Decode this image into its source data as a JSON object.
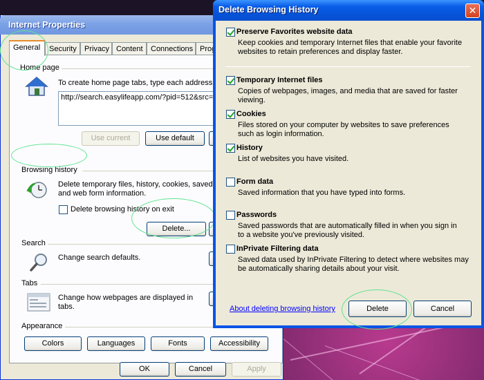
{
  "ie_window": {
    "title": "Internet Properties",
    "tabs": [
      "General",
      "Security",
      "Privacy",
      "Content",
      "Connections",
      "Prog"
    ],
    "home_page": {
      "label": "Home page",
      "description": "To create home page tabs, type each address on",
      "url": "http://search.easylifeapp.com/?pid=512&src=",
      "use_current": "Use current",
      "use_default": "Use default"
    },
    "browsing_history": {
      "label": "Browsing history",
      "description_line1": "Delete temporary files, history, cookies, saved",
      "description_line2": "and web form information.",
      "delete_on_exit": "Delete browsing history on exit",
      "delete_button": "Delete..."
    },
    "search": {
      "label": "Search",
      "description": "Change search defaults."
    },
    "tabs_section": {
      "label": "Tabs",
      "description_line1": "Change how webpages are displayed in",
      "description_line2": "tabs."
    },
    "appearance": {
      "label": "Appearance",
      "colors": "Colors",
      "languages": "Languages",
      "fonts": "Fonts",
      "accessibility": "Accessibility"
    },
    "footer": {
      "ok": "OK",
      "cancel": "Cancel",
      "apply": "Apply"
    }
  },
  "dialog": {
    "title": "Delete Browsing History",
    "options": [
      {
        "title": "Preserve Favorites website data",
        "checked": true,
        "desc1": "Keep cookies and temporary Internet files that enable your favorite",
        "desc2": "websites to retain preferences and display faster."
      },
      {
        "title": "Temporary Internet files",
        "checked": true,
        "desc1": "Copies of webpages, images, and media that are saved for faster",
        "desc2": "viewing."
      },
      {
        "title": "Cookies",
        "checked": true,
        "desc1": "Files stored on your computer by websites to save preferences",
        "desc2": "such as login information."
      },
      {
        "title": "History",
        "checked": true,
        "desc1": "List of websites you have visited.",
        "desc2": ""
      },
      {
        "title": "Form data",
        "checked": false,
        "desc1": "Saved information that you have typed into forms.",
        "desc2": ""
      },
      {
        "title": "Passwords",
        "checked": false,
        "desc1": "Saved passwords that are automatically filled in when you sign in",
        "desc2": "to a website you've previously visited."
      },
      {
        "title": "InPrivate Filtering data",
        "checked": false,
        "desc1": "Saved data used by InPrivate Filtering to detect where websites may",
        "desc2": "be automatically sharing details about your visit."
      }
    ],
    "about_link": "About deleting browsing history",
    "delete_button": "Delete",
    "cancel_button": "Cancel",
    "close_glyph": "✕"
  }
}
